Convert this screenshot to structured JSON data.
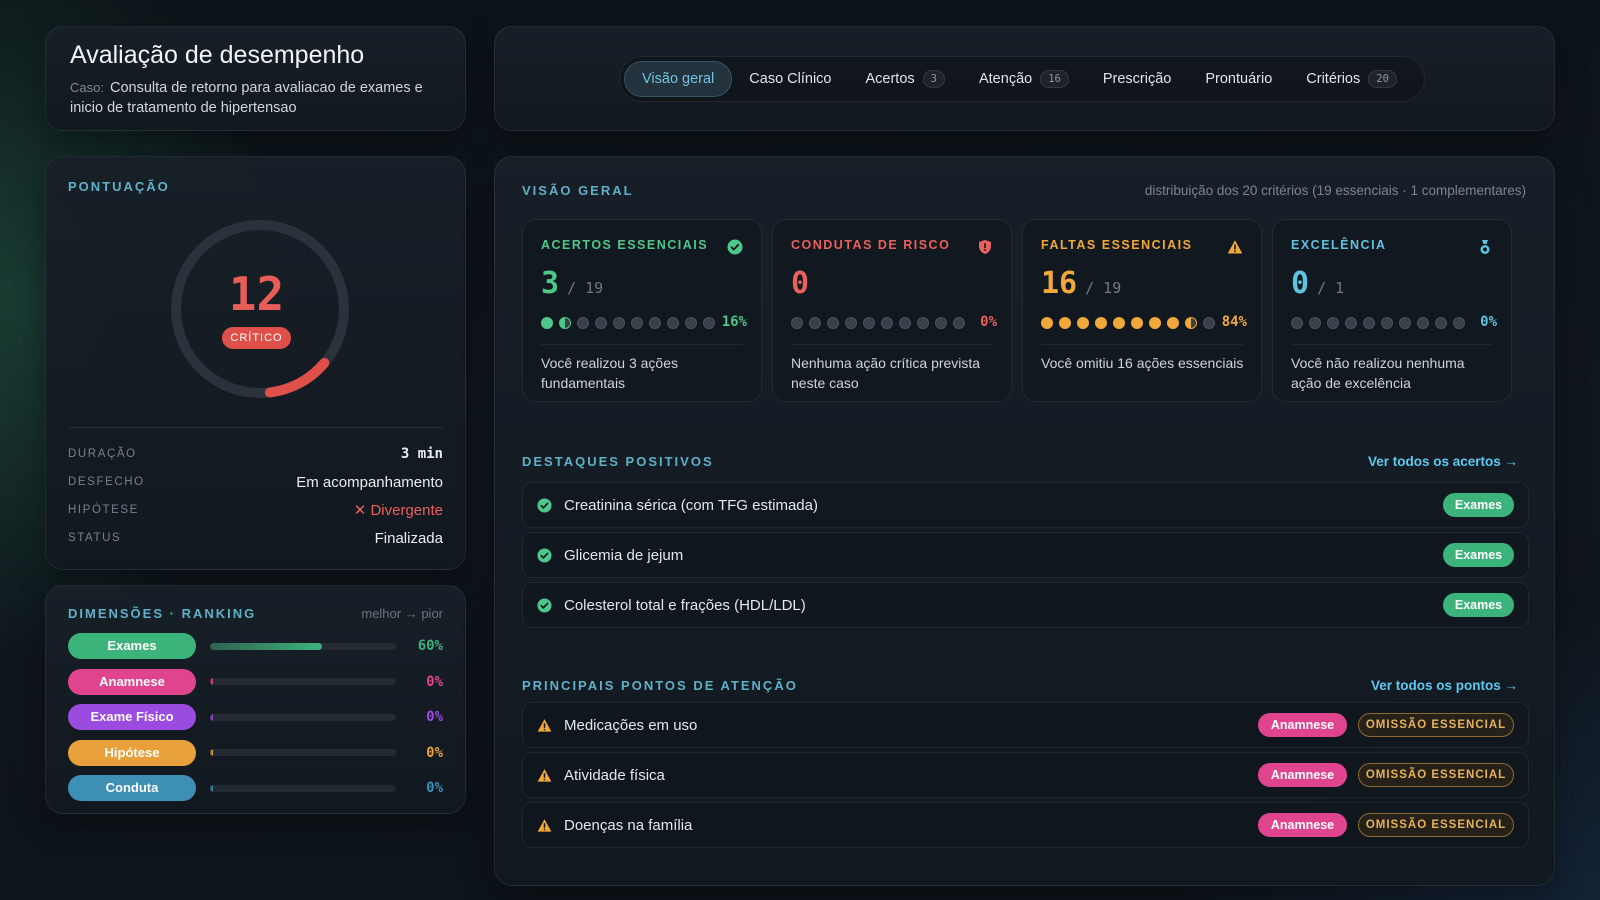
{
  "header": {
    "title": "Avaliação de desempenho",
    "case_label": "Caso:",
    "case_text": "Consulta de retorno para avaliacao de exames e inicio de tratamento de hipertensao"
  },
  "tabs": [
    {
      "label": "Visão geral",
      "count": ""
    },
    {
      "label": "Caso Clínico",
      "count": ""
    },
    {
      "label": "Acertos",
      "count": "3"
    },
    {
      "label": "Atenção",
      "count": "16"
    },
    {
      "label": "Prescrição",
      "count": ""
    },
    {
      "label": "Prontuário",
      "count": ""
    },
    {
      "label": "Critérios",
      "count": "20"
    }
  ],
  "score": {
    "section_title": "PONTUAÇÃO",
    "value": "12",
    "gauge_fraction": 0.12,
    "badge": "CRÍTICO",
    "details": [
      {
        "key": "DURAÇÃO",
        "value": "3 min"
      },
      {
        "key": "DESFECHO",
        "value": "Em acompanhamento"
      },
      {
        "key": "HIPÓTESE",
        "value": "✕ Divergente"
      },
      {
        "key": "STATUS",
        "value": "Finalizada"
      }
    ]
  },
  "dimensions": {
    "title": "DIMENSÕES · RANKING",
    "order_hint": "melhor → pior",
    "items": [
      {
        "label": "Exames",
        "pct": "60%",
        "fill": 0.6,
        "color": "#3db37c"
      },
      {
        "label": "Anamnese",
        "pct": "0%",
        "fill": 0,
        "color": "#e0448e"
      },
      {
        "label": "Exame Físico",
        "pct": "0%",
        "fill": 0,
        "color": "#9b4be0"
      },
      {
        "label": "Hipótese",
        "pct": "0%",
        "fill": 0,
        "color": "#e8a03a"
      },
      {
        "label": "Conduta",
        "pct": "0%",
        "fill": 0,
        "color": "#3d8fb3"
      }
    ]
  },
  "overview": {
    "title": "VISÃO GERAL",
    "subtitle": "distribuição dos 20 critérios (19 essenciais · 1 complementares)",
    "metrics": [
      {
        "title": "ACERTOS ESSENCIAIS",
        "icon": "check-circle-icon",
        "value": "3",
        "total": "/ 19",
        "pct": "16%",
        "filled": 1,
        "half": 1,
        "color": "#4ec78a",
        "desc": "Você realizou 3 ações fundamentais"
      },
      {
        "title": "CONDUTAS DE RISCO",
        "icon": "shield-alert-icon",
        "value": "0",
        "total": "",
        "pct": "0%",
        "filled": 0,
        "half": 0,
        "color": "#e8615c",
        "desc": "Nenhuma ação crítica prevista neste caso"
      },
      {
        "title": "FALTAS ESSENCIAIS",
        "icon": "warning-icon",
        "value": "16",
        "total": "/ 19",
        "pct": "84%",
        "filled": 8,
        "half": 1,
        "color": "#f0a83a",
        "desc": "Você omitiu 16 ações essenciais"
      },
      {
        "title": "EXCELÊNCIA",
        "icon": "medal-icon",
        "value": "0",
        "total": "/ 1",
        "pct": "0%",
        "filled": 0,
        "half": 0,
        "color": "#5fc3e0",
        "desc": "Você não realizou nenhuma ação de excelência"
      }
    ]
  },
  "highlights": {
    "title": "DESTAQUES POSITIVOS",
    "link": "Ver todos os acertos →",
    "items": [
      {
        "label": "Creatinina sérica (com TFG estimada)",
        "tag": "Exames"
      },
      {
        "label": "Glicemia de jejum",
        "tag": "Exames"
      },
      {
        "label": "Colesterol total e frações (HDL/LDL)",
        "tag": "Exames"
      }
    ]
  },
  "attention": {
    "title": "PRINCIPAIS PONTOS DE ATENÇÃO",
    "link": "Ver todos os pontos →",
    "items": [
      {
        "label": "Medicações em uso",
        "tag": "Anamnese",
        "kind": "OMISSÃO ESSENCIAL"
      },
      {
        "label": "Atividade física",
        "tag": "Anamnese",
        "kind": "OMISSÃO ESSENCIAL"
      },
      {
        "label": "Doenças na família",
        "tag": "Anamnese",
        "kind": "OMISSÃO ESSENCIAL"
      }
    ]
  }
}
